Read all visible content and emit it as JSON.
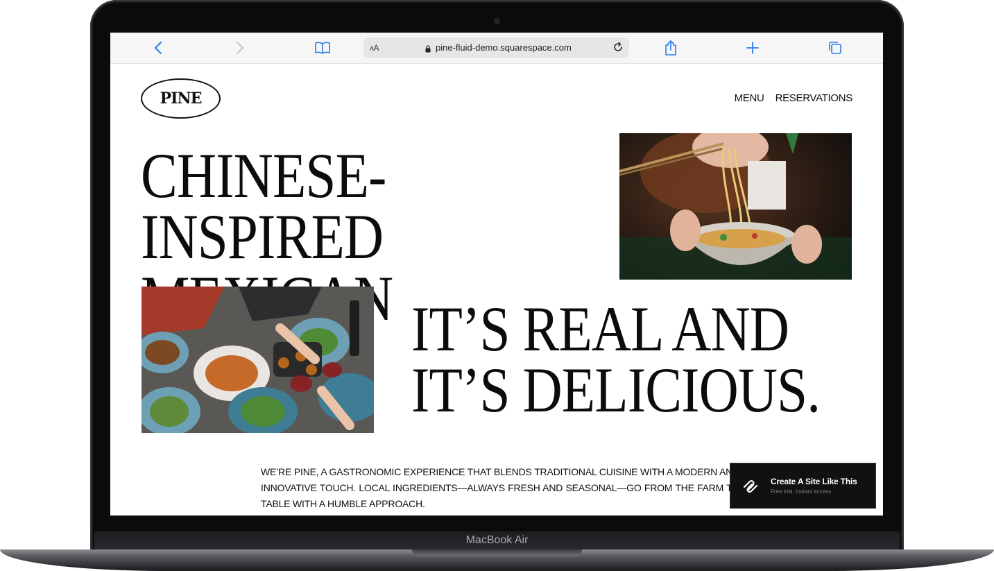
{
  "device": {
    "label": "MacBook Air"
  },
  "browser": {
    "url": "pine-fluid-demo.squarespace.com",
    "text_size_label": "AA"
  },
  "site": {
    "logo": "PINE",
    "nav": [
      "MENU",
      "RESERVATIONS"
    ],
    "headline_1": "Chinese-Inspired Mexican Food.",
    "headline_2": "It’s Real and It’s Delicious.",
    "intro": "We’re Pine, a gastronomic experience that blends traditional cuisine with a modern and innovative touch. Local ingredients—always fresh and seasonal—go from the farm to table with a humble approach."
  },
  "badge": {
    "title": "Create A Site Like This",
    "subtitle": "Free trial. Instant access."
  },
  "colors": {
    "accent": "#2a7cf0",
    "ink": "#0c0c0c",
    "badge_bg": "#111111"
  }
}
